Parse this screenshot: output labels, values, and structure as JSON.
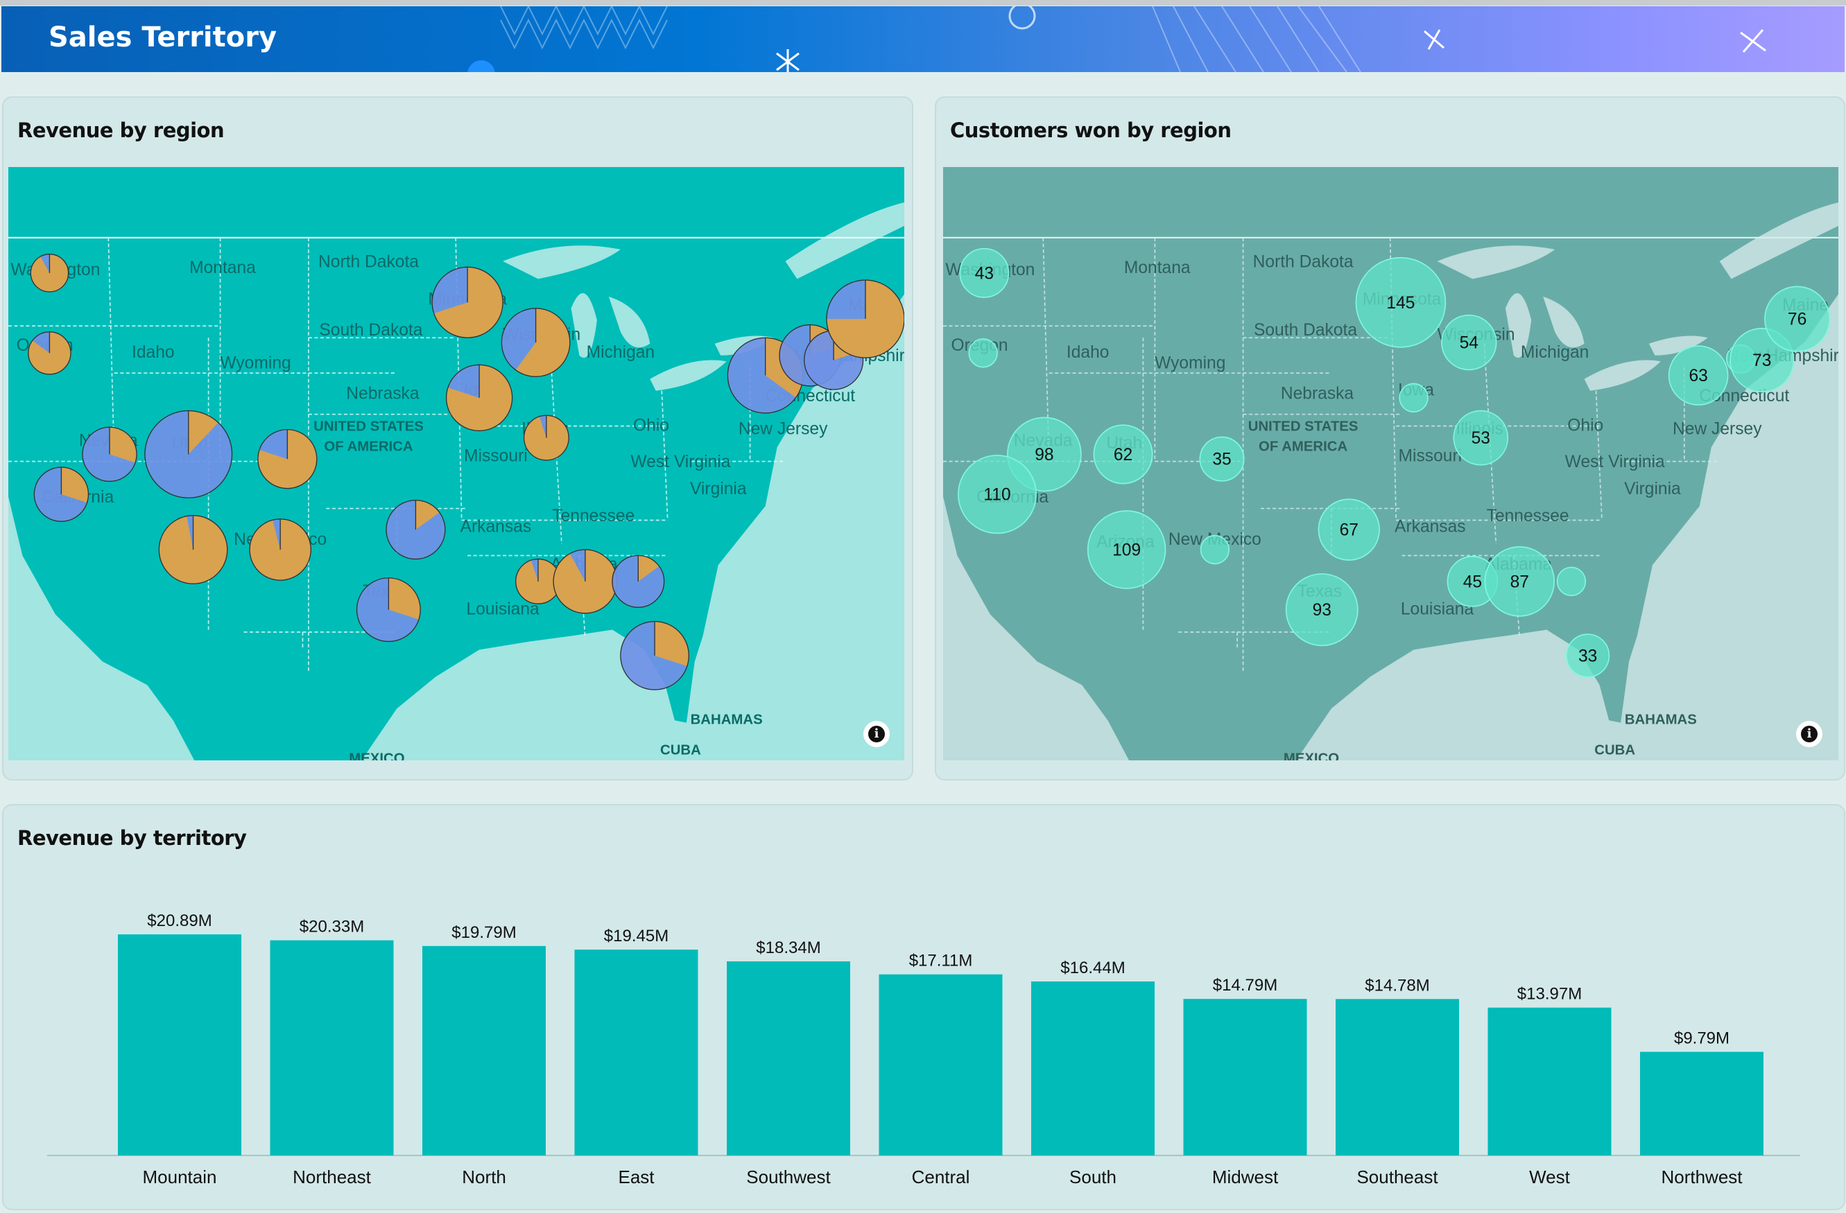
{
  "header": {
    "title": "Sales Territory"
  },
  "panels": {
    "revenue_region": {
      "title": "Revenue by region",
      "info_icon": "info-icon"
    },
    "customers_region": {
      "title": "Customers won by region",
      "info_icon": "info-icon"
    },
    "revenue_territory": {
      "title": "Revenue by territory"
    }
  },
  "map_labels": [
    "Washington",
    "Montana",
    "North Dakota",
    "Minnesota",
    "Oregon",
    "Idaho",
    "South Dakota",
    "Wisconsin",
    "Michigan",
    "Wyoming",
    "New Hampshire",
    "Maine",
    "Nebraska",
    "Iowa",
    "Connecticut",
    "UNITED STATES",
    "OF AMERICA",
    "Ohio",
    "New Jersey",
    "Nevada",
    "Utah",
    "Illinois",
    "Missouri",
    "West Virginia",
    "California",
    "Virginia",
    "Tennessee",
    "Arkansas",
    "Arizona",
    "New Mexico",
    "Texas",
    "Alabama",
    "Louisiana",
    "BAHAMAS",
    "CUBA",
    "MEXICO"
  ],
  "colors": {
    "pie_a": "#d9a24f",
    "pie_b": "#7191e6",
    "bubble": "#5fe3c8",
    "bar": "#00bbb8",
    "map_land_left": "#00bdb8",
    "map_water_left": "#a2e5e1",
    "map_land_right": "#68aca8",
    "map_water_right": "#bddcdb"
  },
  "chart_data": [
    {
      "type": "pie-map",
      "title": "Revenue by region",
      "pies": [
        {
          "share_a": 0.92
        },
        {
          "share_a": 0.85
        },
        {
          "share_a": 0.7
        },
        {
          "share_a": 0.6
        },
        {
          "share_a": 0.8
        },
        {
          "share_a": 0.95
        },
        {
          "share_a": 0.3
        },
        {
          "share_a": 0.12
        },
        {
          "share_a": 0.8
        },
        {
          "share_a": 0.3
        },
        {
          "share_a": 0.97
        },
        {
          "share_a": 0.96
        },
        {
          "share_a": 0.15
        },
        {
          "share_a": 0.3
        },
        {
          "share_a": 0.95
        },
        {
          "share_a": 0.92
        },
        {
          "share_a": 0.15
        },
        {
          "share_a": 0.3
        },
        {
          "share_a": 0.35
        },
        {
          "share_a": 0.2
        },
        {
          "share_a": 0.2
        },
        {
          "share_a": 0.75
        }
      ]
    },
    {
      "type": "bubble-map",
      "title": "Customers won by region",
      "bubbles": [
        43,
        null,
        145,
        54,
        null,
        53,
        98,
        62,
        35,
        110,
        109,
        null,
        67,
        93,
        45,
        87,
        null,
        33,
        63,
        null,
        73,
        76
      ]
    },
    {
      "type": "bar",
      "title": "Revenue by territory",
      "categories": [
        "Mountain",
        "Northeast",
        "North",
        "East",
        "Southwest",
        "Central",
        "South",
        "Midwest",
        "Southeast",
        "West",
        "Northwest"
      ],
      "values": [
        20.89,
        20.33,
        19.79,
        19.45,
        18.34,
        17.11,
        16.44,
        14.79,
        14.78,
        13.97,
        9.79
      ],
      "labels": [
        "$20.89M",
        "$20.33M",
        "$19.79M",
        "$19.45M",
        "$18.34M",
        "$17.11M",
        "$16.44M",
        "$14.79M",
        "$14.78M",
        "$13.97M",
        "$9.79M"
      ],
      "unit": "$M",
      "ylim": [
        0,
        22
      ],
      "grid": false
    }
  ]
}
